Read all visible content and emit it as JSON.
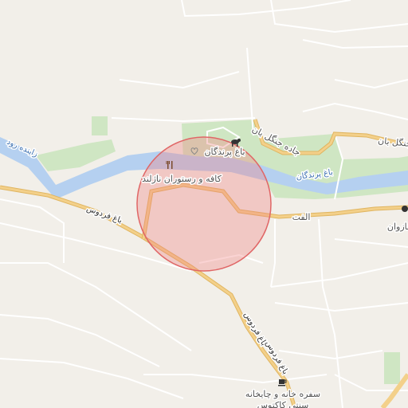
{
  "map": {
    "colors": {
      "background": "#f2efe9",
      "river": "#b5d0f0",
      "park": "#cfe6c3",
      "minor_road": "#ffffff",
      "major_road": "#f3d08a",
      "major_road_casing": "#e0b560",
      "highlight_fill": "#f08080",
      "highlight_stroke": "#e06666"
    },
    "labels": {
      "river_name": "زاینده رود",
      "restaurant": "کافه و رستوران ناژلند",
      "bird_garden_top": "باغ پرندگان",
      "bird_garden_river": "باغ پرندگان",
      "jungle_road": "جاده جنگل بان",
      "jungle_road_2": "جنگل بان",
      "alefat": "الفت",
      "bagh_ferdows_1": "باغ فردوس",
      "bagh_ferdows_2": "باغ فردوس",
      "bagh_ferdows_3": "باغ فردوس",
      "nazvan": "نازوان",
      "teahouse": "سفره خانه و چایخانه",
      "teahouse_2": "سنتی کاکتوس"
    },
    "icons": [
      "restaurant-icon",
      "zoo-animal-icon",
      "teahouse-cup-icon",
      "poi-marker-icon"
    ]
  }
}
